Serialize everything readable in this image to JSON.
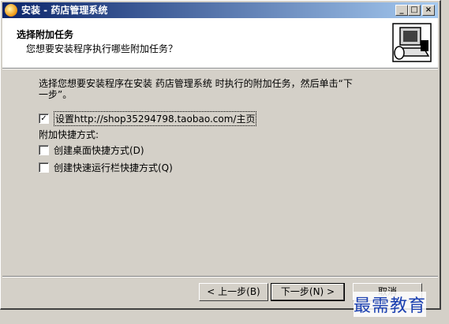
{
  "window": {
    "title": "安装 - 药店管理系统",
    "controls": {
      "minimize": "_",
      "maximize": "□",
      "close": "×"
    }
  },
  "header": {
    "title": "选择附加任务",
    "subtitle": "您想要安装程序执行哪些附加任务？",
    "icon": "installer-computer-icon"
  },
  "content": {
    "description_line1": "选择您想要安装程序在安装 药店管理系统 时执行的附加任务，然后单击“下",
    "description_line2": "一步”。",
    "homepage_task": {
      "label": "设置http://shop35294798.taobao.com/主页",
      "checked": true
    },
    "shortcuts_group_label": "附加快捷方式:",
    "desktop_shortcut": {
      "label": "创建桌面快捷方式(D)",
      "checked": false
    },
    "quicklaunch_shortcut": {
      "label": "创建快速运行栏快捷方式(Q)",
      "checked": false
    }
  },
  "buttons": {
    "back": "< 上一步(B)",
    "next": "下一步(N) >",
    "cancel": "取消"
  },
  "watermark": "最需教育",
  "colors": {
    "titlebar_start": "#0a246a",
    "titlebar_end": "#a6caf0",
    "dialog_bg": "#d4d0c8",
    "watermark": "#1a3fb0"
  }
}
